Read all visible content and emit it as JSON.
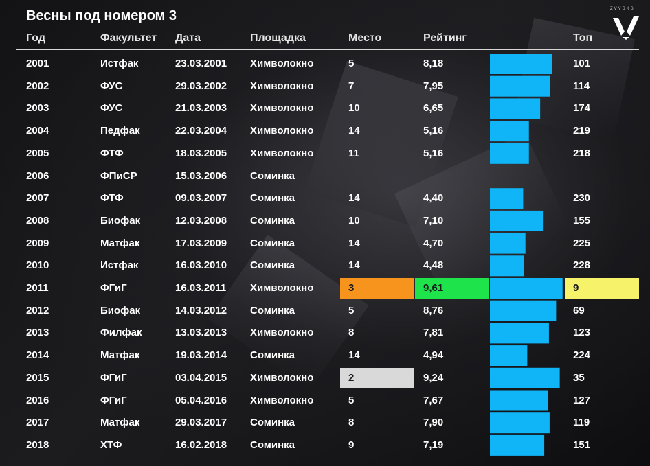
{
  "title": "Весны под номером 3",
  "logo_text": "ZVYSKS",
  "headers": {
    "year": "Год",
    "faculty": "Факультет",
    "date": "Дата",
    "venue": "Площадка",
    "place": "Место",
    "rating": "Рейтинг",
    "top": "Топ"
  },
  "colors": {
    "bar": "#0fb5f7",
    "place_1st_highlight": "#f7941d",
    "place_2nd_highlight": "#d9d9d9",
    "rating_best_highlight": "#1ee34a",
    "top_best_highlight": "#f6f26a"
  },
  "chart_data": {
    "type": "table",
    "title": "Весны под номером 3",
    "columns": [
      "Год",
      "Факультет",
      "Дата",
      "Площадка",
      "Место",
      "Рейтинг",
      "Топ"
    ],
    "bar_column": "Рейтинг",
    "bar_range": [
      0,
      10
    ],
    "rows": [
      {
        "year": "2001",
        "faculty": "Истфак",
        "date": "23.03.2001",
        "venue": "Химволокно",
        "place": "5",
        "rating": "8,18",
        "rating_value": 8.18,
        "top": "101"
      },
      {
        "year": "2002",
        "faculty": "ФУС",
        "date": "29.03.2002",
        "venue": "Химволокно",
        "place": "7",
        "rating": "7,95",
        "rating_value": 7.95,
        "top": "114"
      },
      {
        "year": "2003",
        "faculty": "ФУС",
        "date": "21.03.2003",
        "venue": "Химволокно",
        "place": "10",
        "rating": "6,65",
        "rating_value": 6.65,
        "top": "174"
      },
      {
        "year": "2004",
        "faculty": "Педфак",
        "date": "22.03.2004",
        "venue": "Химволокно",
        "place": "14",
        "rating": "5,16",
        "rating_value": 5.16,
        "top": "219"
      },
      {
        "year": "2005",
        "faculty": "ФТФ",
        "date": "18.03.2005",
        "venue": "Химволокно",
        "place": "11",
        "rating": "5,16",
        "rating_value": 5.16,
        "top": "218"
      },
      {
        "year": "2006",
        "faculty": "ФПиСР",
        "date": "15.03.2006",
        "venue": "Соминка",
        "place": "",
        "rating": "",
        "rating_value": null,
        "top": ""
      },
      {
        "year": "2007",
        "faculty": "ФТФ",
        "date": "09.03.2007",
        "venue": "Соминка",
        "place": "14",
        "rating": "4,40",
        "rating_value": 4.4,
        "top": "230"
      },
      {
        "year": "2008",
        "faculty": "Биофак",
        "date": "12.03.2008",
        "venue": "Соминка",
        "place": "10",
        "rating": "7,10",
        "rating_value": 7.1,
        "top": "155"
      },
      {
        "year": "2009",
        "faculty": "Матфак",
        "date": "17.03.2009",
        "venue": "Соминка",
        "place": "14",
        "rating": "4,70",
        "rating_value": 4.7,
        "top": "225"
      },
      {
        "year": "2010",
        "faculty": "Истфак",
        "date": "16.03.2010",
        "venue": "Соминка",
        "place": "14",
        "rating": "4,48",
        "rating_value": 4.48,
        "top": "228"
      },
      {
        "year": "2011",
        "faculty": "ФГиГ",
        "date": "16.03.2011",
        "venue": "Химволокно",
        "place": "3",
        "rating": "9,61",
        "rating_value": 9.61,
        "top": "9",
        "place_highlight": "place_1st_highlight",
        "rating_highlight": "rating_best_highlight",
        "top_highlight": "top_best_highlight"
      },
      {
        "year": "2012",
        "faculty": "Биофак",
        "date": "14.03.2012",
        "venue": "Соминка",
        "place": "5",
        "rating": "8,76",
        "rating_value": 8.76,
        "top": "69"
      },
      {
        "year": "2013",
        "faculty": "Филфак",
        "date": "13.03.2013",
        "venue": "Химволокно",
        "place": "8",
        "rating": "7,81",
        "rating_value": 7.81,
        "top": "123"
      },
      {
        "year": "2014",
        "faculty": "Матфак",
        "date": "19.03.2014",
        "venue": "Соминка",
        "place": "14",
        "rating": "4,94",
        "rating_value": 4.94,
        "top": "224"
      },
      {
        "year": "2015",
        "faculty": "ФГиГ",
        "date": "03.04.2015",
        "venue": "Химволокно",
        "place": "2",
        "rating": "9,24",
        "rating_value": 9.24,
        "top": "35",
        "place_highlight": "place_2nd_highlight"
      },
      {
        "year": "2016",
        "faculty": "ФГиГ",
        "date": "05.04.2016",
        "venue": "Химволокно",
        "place": "5",
        "rating": "7,67",
        "rating_value": 7.67,
        "top": "127"
      },
      {
        "year": "2017",
        "faculty": "Матфак",
        "date": "29.03.2017",
        "venue": "Соминка",
        "place": "8",
        "rating": "7,90",
        "rating_value": 7.9,
        "top": "119"
      },
      {
        "year": "2018",
        "faculty": "ХТФ",
        "date": "16.02.2018",
        "venue": "Соминка",
        "place": "9",
        "rating": "7,19",
        "rating_value": 7.19,
        "top": "151"
      }
    ]
  }
}
